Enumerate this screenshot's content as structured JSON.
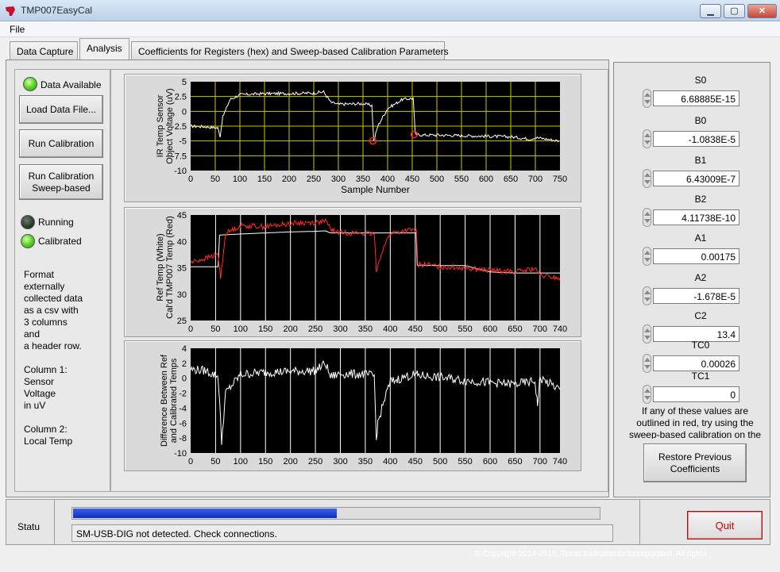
{
  "window": {
    "title": "TMP007EasyCal",
    "minimize": "▁",
    "maximize": "▢",
    "close": "✕"
  },
  "menu": {
    "file": "File"
  },
  "tabs": [
    {
      "label": "Data Capture"
    },
    {
      "label": "Analysis"
    },
    {
      "label": "Coefficients for Registers (hex) and Sweep-based Calibration Parameters"
    }
  ],
  "left_panel": {
    "data_available_label": "Data Available",
    "data_available_on": true,
    "load_button": "Load Data File...",
    "run_calibration_button": "Run Calibration",
    "run_sweep_button_line1": "Run Calibration",
    "run_sweep_button_line2": "Sweep-based",
    "running_label": "Running",
    "running_on": false,
    "calibrated_label": "Calibrated",
    "calibrated_on": true,
    "note": "Format\nexternally\ncollected data\nas a csv with\n3 columns\nand\na header row.\n\nColumn 1:\nSensor\nVoltage\nin uV\n\nColumn 2:\nLocal Temp"
  },
  "colors": {
    "plot_bg": "#000000",
    "grid_yellow": "#c8c800",
    "trace_white": "#ffffff",
    "trace_red": "#ff2a2a",
    "progress_blue": "#1c3fd6",
    "quit_red": "#d10000"
  },
  "chart_data": [
    {
      "type": "line",
      "ylabel": "IR Temp Sensor Object Voltage (uV)",
      "xlabel": "Sample Number",
      "xlim": [
        0,
        750
      ],
      "ylim": [
        -10,
        5
      ],
      "xticks": [
        "0",
        "50",
        "100",
        "150",
        "200",
        "250",
        "300",
        "350",
        "400",
        "450",
        "500",
        "550",
        "600",
        "650",
        "700",
        "750"
      ],
      "yticks": [
        "5",
        "2.5",
        "0",
        "-2.5",
        "-5",
        "-7.5",
        "-10"
      ],
      "grid": true,
      "series": [
        {
          "x": [
            0,
            30,
            55,
            60,
            65,
            80,
            100,
            150,
            200,
            250,
            270,
            285,
            300,
            350,
            368,
            372,
            380,
            400,
            430,
            452,
            456,
            470,
            500,
            550,
            600,
            650,
            690,
            700,
            748
          ],
          "y": [
            -2.5,
            -2.6,
            -2.8,
            -4.2,
            -1,
            2,
            2.8,
            3,
            3,
            3.1,
            3.3,
            1.5,
            1.2,
            1.3,
            1.0,
            -5.0,
            -2.5,
            0.5,
            2.0,
            2.2,
            -3.8,
            -4.0,
            -4.0,
            -4.1,
            -4.2,
            -4.3,
            -4.7,
            -4.4,
            -5.0
          ]
        }
      ],
      "markers": [
        {
          "x": 370,
          "y": -5
        },
        {
          "x": 454,
          "y": -3.9
        }
      ]
    },
    {
      "type": "line",
      "ylabel": "Ref Temp (White) Cal'd TMP007 Temp (Red)",
      "xlabel": "",
      "xlim": [
        0,
        740
      ],
      "ylim": [
        25,
        45
      ],
      "xticks": [
        "0",
        "50",
        "100",
        "150",
        "200",
        "250",
        "300",
        "350",
        "400",
        "450",
        "500",
        "550",
        "600",
        "650",
        "700",
        "740"
      ],
      "yticks": [
        "45",
        "40",
        "35",
        "30",
        "25"
      ],
      "grid": true,
      "series": [
        {
          "x": [
            0,
            55,
            58,
            100,
            150,
            200,
            250,
            270,
            280,
            300,
            350,
            368,
            372,
            400,
            450,
            452,
            454,
            500,
            550,
            600,
            650,
            700,
            740
          ],
          "y": [
            35.2,
            35.2,
            41.2,
            41.4,
            41.6,
            41.8,
            41.9,
            42.0,
            41.6,
            41.6,
            41.6,
            41.6,
            41.6,
            41.6,
            41.6,
            41.6,
            35.5,
            35.4,
            35.4,
            34.2,
            34.0,
            34.0,
            34.0
          ]
        },
        {
          "x": [
            0,
            30,
            55,
            60,
            70,
            100,
            150,
            200,
            250,
            270,
            285,
            300,
            350,
            368,
            372,
            385,
            400,
            430,
            452,
            455,
            470,
            500,
            550,
            600,
            650,
            690,
            700,
            740
          ],
          "y": [
            36,
            36.8,
            37.5,
            33,
            41.5,
            43,
            42.8,
            43.4,
            43.6,
            43.8,
            42,
            41.7,
            41.5,
            41.3,
            34.5,
            38.5,
            41.5,
            42,
            42.2,
            35.5,
            35.6,
            35.2,
            35,
            34.5,
            34.2,
            34.8,
            33.5,
            33.0
          ]
        }
      ]
    },
    {
      "type": "line",
      "ylabel": "Difference Between Ref and Calibrated Temps",
      "xlabel": "",
      "xlim": [
        0,
        740
      ],
      "ylim": [
        -10,
        4
      ],
      "xticks": [
        "0",
        "50",
        "100",
        "150",
        "200",
        "250",
        "300",
        "350",
        "400",
        "450",
        "500",
        "550",
        "600",
        "650",
        "700",
        "740"
      ],
      "yticks": [
        "4",
        "2",
        "0",
        "-2",
        "-4",
        "-6",
        "-8",
        "-10"
      ],
      "grid": true,
      "series": [
        {
          "x": [
            0,
            30,
            55,
            58,
            62,
            70,
            100,
            150,
            200,
            250,
            270,
            280,
            300,
            350,
            368,
            372,
            375,
            390,
            400,
            430,
            450,
            455,
            470,
            500,
            550,
            600,
            650,
            690,
            695,
            700,
            740
          ],
          "y": [
            1.2,
            1.0,
            0.2,
            -3,
            -8.6,
            -2,
            0.5,
            0.8,
            0.9,
            1.0,
            2.0,
            0.2,
            0.6,
            0.5,
            0.3,
            -8.3,
            -6,
            -2.5,
            -0.5,
            0.2,
            0.5,
            0.4,
            0.3,
            0.1,
            -0.3,
            -0.6,
            -0.8,
            -0.4,
            -3.5,
            0.0,
            -1.5
          ]
        }
      ]
    }
  ],
  "coefficients": [
    {
      "label": "S0",
      "value": "6.68885E-15"
    },
    {
      "label": "B0",
      "value": "-1.0838E-5"
    },
    {
      "label": "B1",
      "value": "6.43009E-7"
    },
    {
      "label": "B2",
      "value": "4.11738E-10"
    },
    {
      "label": "A1",
      "value": "0.00175"
    },
    {
      "label": "A2",
      "value": "-1.678E-5"
    },
    {
      "label": "C2",
      "value": "13.4"
    },
    {
      "label": "TC0",
      "value": "0.00026"
    },
    {
      "label": "TC1",
      "value": "0"
    }
  ],
  "hint": "If any of these values are outlined in red, try using the sweep-based calibration on the",
  "restore_button_line1": "Restore Previous",
  "restore_button_line2": "Coefficients",
  "status": {
    "label": "Statu",
    "progress": 0.5,
    "message": "SM-USB-DIG not detected. Check connections."
  },
  "quit_button": "Quit",
  "copyright": "© Copyright 2014-2015, Texas Instruments Incorporated. All rights"
}
